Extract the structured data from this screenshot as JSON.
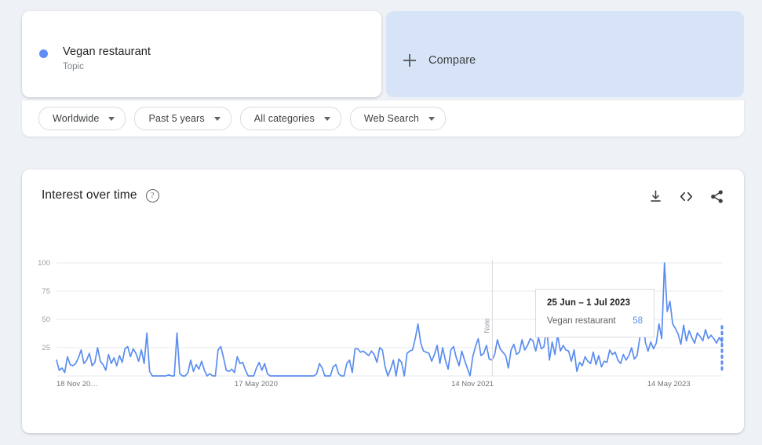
{
  "search_term": {
    "name": "Vegan restaurant",
    "type": "Topic",
    "dot_color": "#5e8df5"
  },
  "compare": {
    "label": "Compare",
    "icon": "plus-icon",
    "bg_color": "#d7e3f7"
  },
  "filters": [
    {
      "label": "Worldwide",
      "name": "location"
    },
    {
      "label": "Past 5 years",
      "name": "time-range"
    },
    {
      "label": "All categories",
      "name": "category"
    },
    {
      "label": "Web Search",
      "name": "search-type"
    }
  ],
  "chart_card": {
    "title": "Interest over time",
    "help_glyph": "?",
    "actions": [
      {
        "name": "download-icon",
        "label": "Download"
      },
      {
        "name": "embed-code-icon",
        "label": "Embed"
      },
      {
        "name": "share-icon",
        "label": "Share"
      }
    ]
  },
  "tooltip": {
    "date_range": "25 Jun – 1 Jul 2023",
    "series_name": "Vegan restaurant",
    "value": "58",
    "value_color": "#5b8def"
  },
  "annotation": {
    "note_label": "Note"
  },
  "chart_data": {
    "type": "line",
    "title": "Interest over time",
    "xlabel": "",
    "ylabel": "",
    "ylim": [
      0,
      100
    ],
    "yticks": [
      "100",
      "75",
      "50",
      "25"
    ],
    "ytick_values": [
      100,
      75,
      50,
      25
    ],
    "xticks": [
      "18 Nov 20…",
      "17 May 2020",
      "14 Nov 2021",
      "14 May 2023"
    ],
    "xtick_positions": [
      0,
      0.3,
      0.625,
      0.92
    ],
    "grid": true,
    "legend": false,
    "line_color": "#5b8def",
    "line_width": 1.7,
    "partial_data_dotted_tail": true,
    "note_marker_position": 0.655,
    "highlight": {
      "label": "25 Jun – 1 Jul 2023",
      "value": 58
    },
    "series": [
      {
        "name": "Vegan restaurant",
        "values": [
          14,
          5,
          7,
          3,
          17,
          10,
          9,
          11,
          16,
          23,
          11,
          14,
          20,
          9,
          12,
          25,
          13,
          10,
          5,
          19,
          11,
          16,
          9,
          18,
          12,
          24,
          26,
          17,
          24,
          20,
          13,
          23,
          11,
          38,
          4,
          0,
          0,
          0,
          0,
          0,
          0,
          1,
          0,
          0,
          38,
          2,
          0,
          0,
          3,
          14,
          4,
          10,
          6,
          13,
          5,
          0,
          2,
          0,
          0,
          23,
          26,
          16,
          5,
          4,
          6,
          3,
          17,
          11,
          12,
          5,
          0,
          0,
          0,
          7,
          12,
          5,
          11,
          2,
          0,
          0,
          0,
          0,
          0,
          0,
          0,
          0,
          0,
          0,
          0,
          0,
          0,
          0,
          0,
          0,
          0,
          2,
          11,
          7,
          0,
          0,
          0,
          8,
          10,
          2,
          0,
          0,
          11,
          14,
          3,
          24,
          24,
          21,
          22,
          20,
          18,
          22,
          19,
          12,
          25,
          23,
          8,
          0,
          6,
          14,
          0,
          15,
          12,
          0,
          20,
          22,
          23,
          33,
          46,
          29,
          22,
          21,
          20,
          13,
          19,
          27,
          11,
          25,
          14,
          6,
          23,
          26,
          16,
          9,
          22,
          14,
          7,
          0,
          17,
          26,
          33,
          18,
          20,
          27,
          15,
          14,
          19,
          32,
          24,
          21,
          18,
          7,
          23,
          28,
          19,
          21,
          32,
          23,
          27,
          33,
          31,
          22,
          34,
          24,
          26,
          43,
          14,
          30,
          19,
          36,
          22,
          27,
          23,
          22,
          13,
          23,
          4,
          12,
          9,
          17,
          13,
          11,
          21,
          10,
          18,
          8,
          13,
          12,
          23,
          19,
          21,
          14,
          11,
          19,
          14,
          18,
          25,
          15,
          18,
          34,
          58,
          30,
          22,
          30,
          24,
          29,
          46,
          33,
          100,
          57,
          66,
          46,
          42,
          37,
          28,
          45,
          31,
          40,
          34,
          29,
          38,
          35,
          31,
          41,
          33,
          36,
          33,
          29,
          34,
          30
        ]
      }
    ]
  }
}
